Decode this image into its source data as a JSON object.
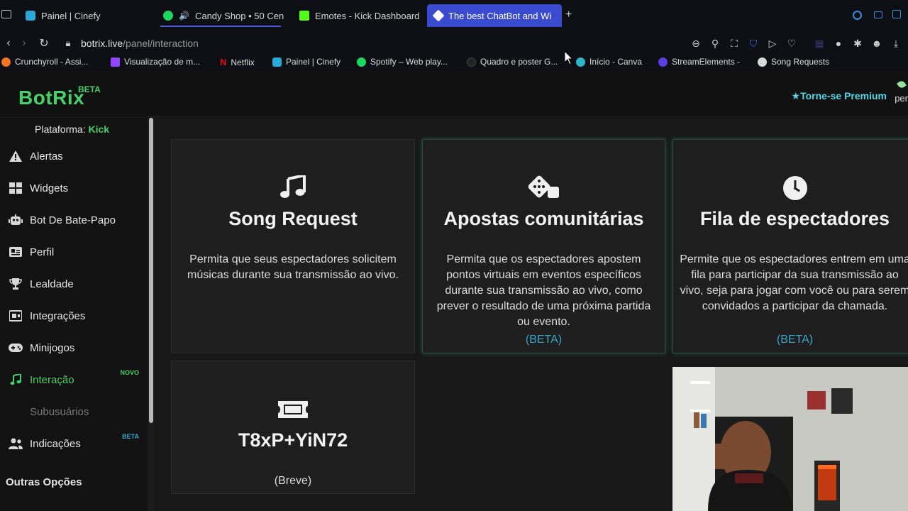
{
  "browser": {
    "tabs": [
      {
        "label": "Painel | Cinefy",
        "icon": "cinefy-favicon"
      },
      {
        "label": "Candy Shop • 50 Cen",
        "icon": "spotify-favicon",
        "audio": "speaker-icon"
      },
      {
        "label": "Emotes - Kick Dashboard",
        "icon": "kick-favicon"
      },
      {
        "label": "The best ChatBot and Wi",
        "icon": "botrix-favicon"
      }
    ],
    "new_tab": "+",
    "url_host": "botrix.live",
    "url_path": "/panel/interaction",
    "bookmarks": [
      {
        "label": "Crunchyroll - Assi..."
      },
      {
        "label": "Visualização de m..."
      },
      {
        "label": "Netflix"
      },
      {
        "label": "Painel | Cinefy"
      },
      {
        "label": "Spotify – Web play..."
      },
      {
        "label": "Quadro e poster G..."
      },
      {
        "label": "Início - Canva"
      },
      {
        "label": "StreamElements -"
      },
      {
        "label": "Song Requests"
      }
    ]
  },
  "header": {
    "logo": "BotRix",
    "logo_badge": "BETA",
    "premium": "Torne-se Premium",
    "user_partial": "per"
  },
  "sidebar": {
    "platform_label": "Plataforma:",
    "platform_value": "Kick",
    "items": [
      {
        "label": "Alertas",
        "icon": "warning-icon"
      },
      {
        "label": "Widgets",
        "icon": "grid-icon"
      },
      {
        "label": "Bot De Bate-Papo",
        "icon": "robot-icon"
      },
      {
        "label": "Perfil",
        "icon": "id-card-icon"
      },
      {
        "label": "Lealdade",
        "icon": "trophy-icon"
      },
      {
        "label": "Integrações",
        "icon": "integration-icon"
      },
      {
        "label": "Minijogos",
        "icon": "gamepad-icon"
      },
      {
        "label": "Interação",
        "icon": "music-icon",
        "badge": "NOVO",
        "active": true
      },
      {
        "label": "Subusuários",
        "icon": "subusers-icon",
        "disabled": true
      },
      {
        "label": "Indicações",
        "icon": "users-icon",
        "badge": "BETA"
      }
    ],
    "section_other": "Outras Opções",
    "accent": "#4ad06a"
  },
  "cards": [
    {
      "title": "Song Request",
      "icon": "music-note-icon",
      "description": "Permita que seus espectadores solicitem músicas durante sua transmissão ao vivo."
    },
    {
      "title": "Apostas comunitárias",
      "icon": "dice-icon",
      "description": "Permita que os espectadores apostem pontos virtuais em eventos específicos durante sua transmissão ao vivo, como prever o resultado de uma próxima partida ou evento.",
      "badge": "(BETA)"
    },
    {
      "title": "Fila de espectadores",
      "icon": "clock-icon",
      "description": "Permite que os espectadores entrem em uma fila para participar da sua transmissão ao vivo, seja para jogar com você ou para serem convidados a participar da chamada.",
      "badge": "(BETA)"
    },
    {
      "title": "T8xP+YiN72",
      "icon": "ticket-icon",
      "description": "(Breve)"
    }
  ]
}
